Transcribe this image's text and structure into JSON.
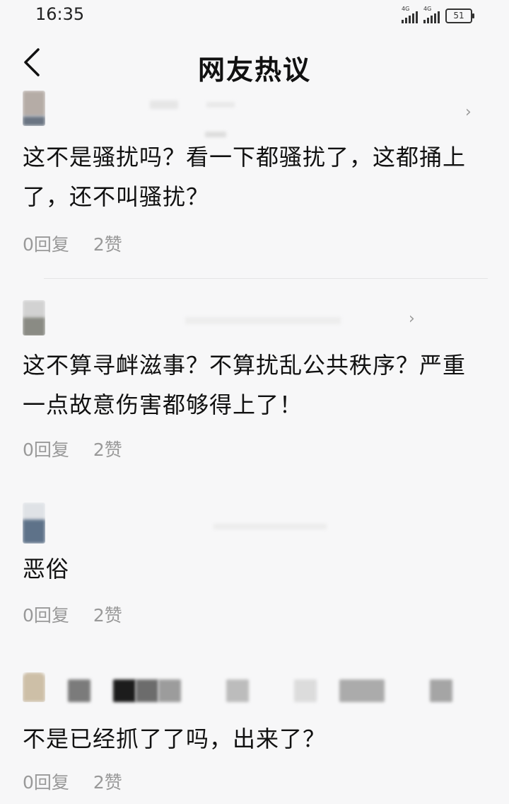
{
  "status_bar": {
    "time": "16:35",
    "network_1": "4G",
    "network_2": "4G",
    "battery": "51"
  },
  "nav": {
    "back_icon": "chevron-left-icon",
    "title": "网友热议"
  },
  "comments": [
    {
      "text": "这不是骚扰吗？看一下都骚扰了，这都捅上了，还不叫骚扰？",
      "replies": "0回复",
      "likes": "2赞"
    },
    {
      "text": "这不算寻衅滋事？不算扰乱公共秩序？严重一点故意伤害都够得上了！",
      "replies": "0回复",
      "likes": "2赞"
    },
    {
      "text": "恶俗",
      "replies": "0回复",
      "likes": "2赞"
    },
    {
      "text": "不是已经抓了了吗，出来了？",
      "replies": "0回复",
      "likes": "2赞"
    }
  ],
  "colors": {
    "background": "#f7f7f8",
    "text": "#111111",
    "meta": "#999999"
  }
}
